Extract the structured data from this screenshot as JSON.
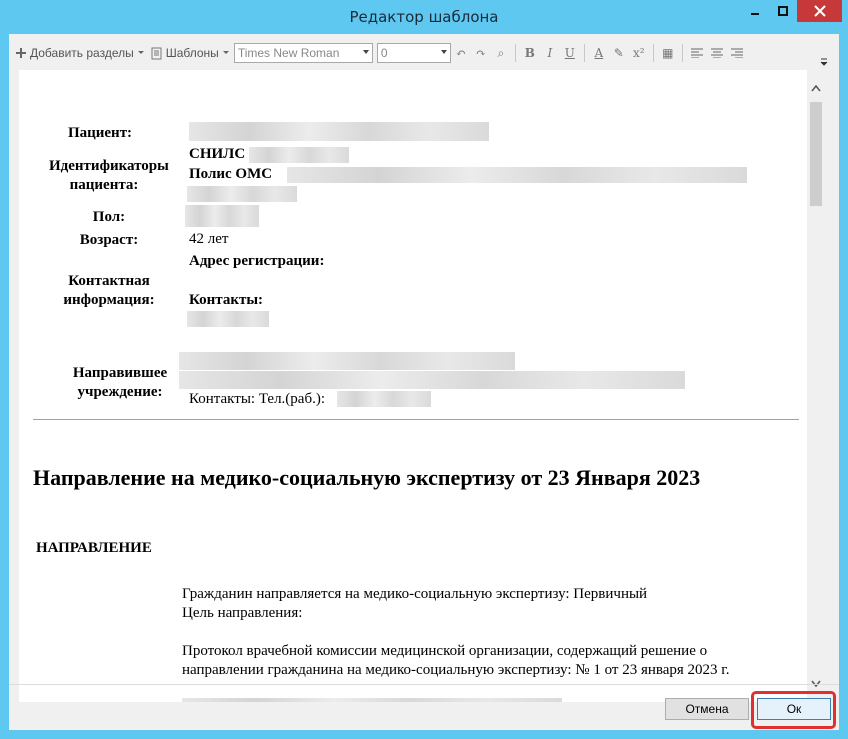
{
  "window": {
    "title": "Редактор шаблона"
  },
  "toolbar": {
    "add_sections": "Добавить разделы",
    "templates": "Шаблоны",
    "font_family": "Times New Roman",
    "font_size": "0"
  },
  "patient": {
    "patient_label": "Пациент:",
    "ids_label": "Идентификаторы пациента:",
    "snils_label": "СНИЛС",
    "oms_label": "Полис ОМС",
    "sex_label": "Пол:",
    "age_label": "Возраст:",
    "age_value": "42 лет",
    "contact_label": "Контактная информация:",
    "address_label": "Адрес регистрации:",
    "contacts_label": "Контакты:",
    "referring_label": "Направившее учреждение:",
    "contacts_phone": "Контакты: Тел.(раб.):"
  },
  "document": {
    "heading": "Направление на медико-социальную экспертизу от 23 Января 2023",
    "section_title": "НАПРАВЛЕНИЕ",
    "line1": "Гражданин направляется на медико-социальную экспертизу: Первичный",
    "line2": "Цель направления:",
    "line3": "Протокол врачебной комиссии медицинской организации, содержащий решение о",
    "line4": "направлении гражданина на медико-социальную экспертизу: № 1 от 23 января 2023 г."
  },
  "buttons": {
    "cancel": "Отмена",
    "ok": "Ок"
  }
}
